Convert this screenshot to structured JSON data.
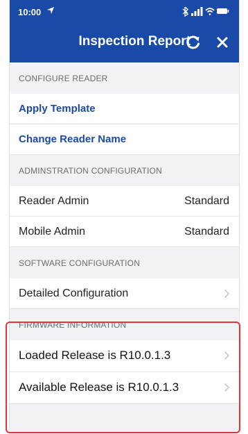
{
  "status_bar": {
    "time": "10:00",
    "icons": [
      "location-arrow-icon",
      "bluetooth-icon",
      "signal-icon",
      "wifi-icon",
      "battery-icon"
    ]
  },
  "navbar": {
    "title": "Inspection Report",
    "refresh_icon": "refresh-icon",
    "close_icon": "close-icon"
  },
  "colors": {
    "brand": "#1a4aa8",
    "highlight": "#e3343a",
    "background": "#f2f2f4"
  },
  "sections": {
    "configure_reader": {
      "header": "CONFIGURE READER",
      "items": [
        "Apply Template",
        "Change Reader Name"
      ]
    },
    "administration": {
      "header": "ADMINSTRATION CONFIGURATION",
      "rows": [
        {
          "label": "Reader Admin",
          "value": "Standard"
        },
        {
          "label": "Mobile Admin",
          "value": "Standard"
        }
      ]
    },
    "software": {
      "header": "SOFTWARE CONFIGURATION",
      "rows": [
        {
          "label": "Detailed Configuration"
        }
      ]
    },
    "firmware": {
      "header": "FIRMWARE INFORMATION",
      "rows": [
        {
          "label": "Loaded Release is R10.0.1.3"
        },
        {
          "label": "Available Release is R10.0.1.3"
        }
      ]
    }
  }
}
